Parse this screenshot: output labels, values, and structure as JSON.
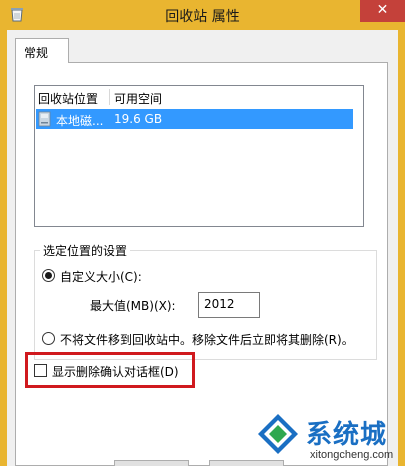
{
  "window": {
    "title": "回收站 属性",
    "close_glyph": "✕"
  },
  "tabs": [
    {
      "label": "常规",
      "active": true
    }
  ],
  "list": {
    "columns": [
      "回收站位置",
      "可用空间"
    ],
    "rows": [
      {
        "location": "本地磁...",
        "free_space": "19.6 GB",
        "selected": true
      }
    ]
  },
  "settings": {
    "legend": "选定位置的设置",
    "custom_size_label": "自定义大小(C):",
    "custom_size_checked": true,
    "max_size_label": "最大值(MB)(X):",
    "max_size_value": "2012",
    "no_move_label": "不将文件移到回收站中。移除文件后立即将其删除(R)。",
    "no_move_checked": false
  },
  "confirm": {
    "label": "显示删除确认对话框(D)",
    "checked": false
  },
  "watermark": {
    "name": "系统城",
    "url": "xitongcheng.com"
  },
  "colors": {
    "frame": "#e9b530",
    "close": "#c4413a",
    "selection": "#3399ff",
    "highlight": "#d0191e",
    "watermark": "#1a6fc3"
  }
}
